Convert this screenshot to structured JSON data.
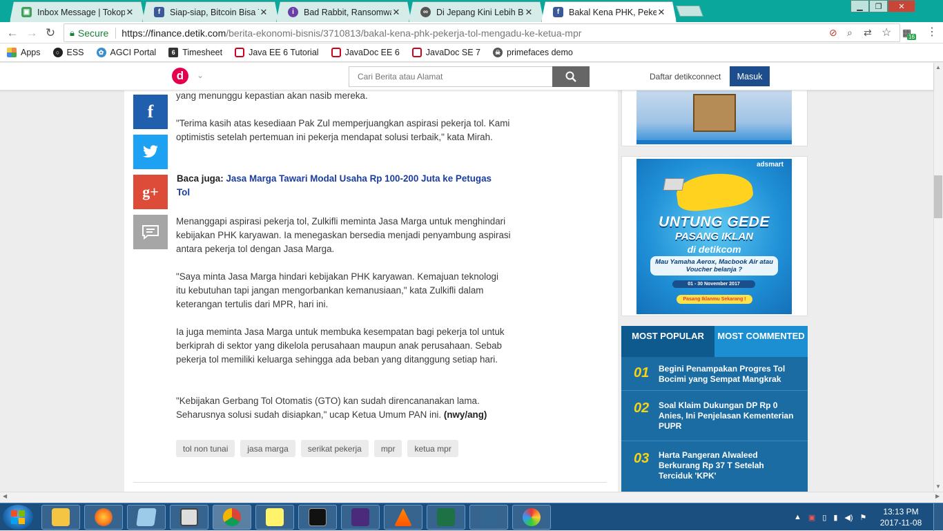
{
  "browser": {
    "tabs": [
      {
        "title": "Inbox Message | Tokope",
        "icon": "tokopedia-icon",
        "color": "#42a05c"
      },
      {
        "title": "Siap-siap, Bitcoin Bisa Te",
        "icon": "facebook-icon",
        "color": "#3b5998"
      },
      {
        "title": "Bad Rabbit, Ransomware",
        "icon": "info-icon",
        "color": "#6a3fa8"
      },
      {
        "title": "Di Jepang Kini Lebih Ban",
        "icon": "glasses-icon",
        "color": "#444444"
      },
      {
        "title": "Bakal Kena PHK, Pekerja",
        "icon": "facebook-icon",
        "color": "#3b5998"
      }
    ],
    "secure_label": "Secure",
    "url_host": "https://finance.detik.com",
    "url_path": "/berita-ekonomi-bisnis/3710813/bakal-kena-phk-pekerja-tol-mengadu-ke-ketua-mpr",
    "extension_badge": "16",
    "bookmarks": [
      {
        "label": "Apps",
        "icon": "apps-grid-icon"
      },
      {
        "label": "ESS",
        "icon": "ess-icon"
      },
      {
        "label": "AGCI Portal",
        "icon": "agci-icon"
      },
      {
        "label": "Timesheet",
        "icon": "timesheet-icon"
      },
      {
        "label": "Java EE 6 Tutorial",
        "icon": "oracle-icon"
      },
      {
        "label": "JavaDoc EE 6",
        "icon": "oracle-icon"
      },
      {
        "label": "JavaDoc SE 7",
        "icon": "oracle-icon"
      },
      {
        "label": "primefaces demo",
        "icon": "primefaces-icon"
      }
    ]
  },
  "header": {
    "logo_letter": "d",
    "search_placeholder": "Cari Berita atau Alamat",
    "daftar_label": "Daftar detikconnect",
    "masuk_label": "Masuk"
  },
  "article": {
    "p0": "yang menunggu kepastian akan nasib mereka.",
    "p1": "\"Terima kasih atas kesediaan Pak Zul memperjuangkan aspirasi pekerja tol. Kami optimistis setelah pertemuan ini pekerja mendapat solusi terbaik,\" kata Mirah.",
    "baca_label": "Baca juga:",
    "baca_link": "Jasa Marga Tawari Modal Usaha Rp 100-200 Juta ke Petugas Tol",
    "p2": "Menanggapi aspirasi pekerja tol, Zulkifli meminta Jasa Marga untuk menghindari kebijakan PHK karyawan. Ia menegaskan bersedia menjadi penyambung aspirasi antara pekerja tol dengan Jasa Marga.",
    "p3": "\"Saya minta Jasa Marga hindari kebijakan PHK karyawan. Kemajuan teknologi itu kebutuhan tapi jangan mengorbankan kemanusiaan,\" kata Zulkifli dalam keterangan tertulis dari MPR, hari ini.",
    "p4": "Ia juga meminta Jasa Marga untuk membuka kesempatan bagi pekerja tol untuk berkiprah di sektor yang dikelola perusahaan maupun anak perusahaan. Sebab pekerja tol memiliki keluarga sehingga ada beban yang ditanggung setiap hari.",
    "p5": "\"Kebijakan Gerbang Tol Otomatis (GTO) kan sudah direncananakan lama. Seharusnya solusi sudah disiapkan,\" ucap Ketua Umum PAN ini.",
    "p5_credit": "(nwy/ang)",
    "tags": [
      "tol non tunai",
      "jasa marga",
      "serikat pekerja",
      "mpr",
      "ketua mpr"
    ]
  },
  "ads": {
    "ad2_brand": "adsmart",
    "ad2_line1": "UNTUNG GEDE",
    "ad2_line2": "PASANG IKLAN",
    "ad2_line3": "di detikcom",
    "ad2_line4": "Mau Yamaha Aerox, Macbook Air atau Voucher belanja ?",
    "ad2_dates": "01 - 30 November 2017",
    "ad2_cta": "Pasang Iklanmu Sekarang !"
  },
  "popular": {
    "tab1": "MOST POPULAR",
    "tab2": "MOST COMMENTED",
    "items": [
      {
        "num": "01",
        "title": "Begini Penampakan Progres Tol Bocimi yang Sempat Mangkrak"
      },
      {
        "num": "02",
        "title": "Soal Klaim Dukungan DP Rp 0 Anies, Ini Penjelasan Kementerian PUPR"
      },
      {
        "num": "03",
        "title": "Harta Pangeran Alwaleed Berkurang Rp 37 T Setelah Terciduk 'KPK'"
      }
    ]
  },
  "taskbar": {
    "time": "13:13 PM",
    "date": "2017-11-08"
  }
}
